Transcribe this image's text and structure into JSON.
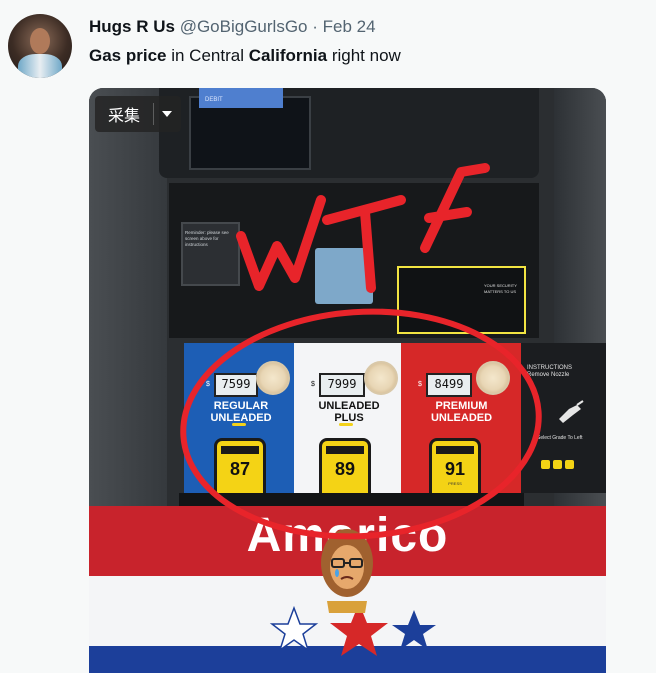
{
  "tweet": {
    "display_name": "Hugs R Us",
    "handle": "@GoBigGurlsGo",
    "separator": "·",
    "date": "Feb 24",
    "text_parts": {
      "p1": "Gas price",
      "p2": " in Central ",
      "p3": "California",
      "p4": " right now"
    }
  },
  "overlay": {
    "collect_label": "采集"
  },
  "photo": {
    "annotation": "WTF",
    "brand": "Amorico",
    "screen_label": "DEBIT",
    "ada_text": "Reminder: please see screen above for instructions",
    "card_label": "YOUR SECURITY MATTERS TO US",
    "instructions": "INSTRUCTIONS Remove Nozzle",
    "select_grade": "Select Grade To Left",
    "grades": [
      {
        "name_line1": "REGULAR",
        "name_line2": "UNLEADED",
        "price": "7599",
        "octane": "87"
      },
      {
        "name_line1": "UNLEADED",
        "name_line2": "PLUS",
        "price": "7999",
        "octane": "89"
      },
      {
        "name_line1": "PREMIUM",
        "name_line2": "UNLEADED",
        "price": "8499",
        "octane": "91"
      }
    ],
    "dollar_sign": "$",
    "press_label": "PRESS"
  },
  "colors": {
    "pump_blue": "#1d5eb5",
    "pump_red": "#d62828",
    "pump_white": "#f4f5f7",
    "grade_yellow": "#f4d315",
    "annotation_red": "#e8242a"
  }
}
